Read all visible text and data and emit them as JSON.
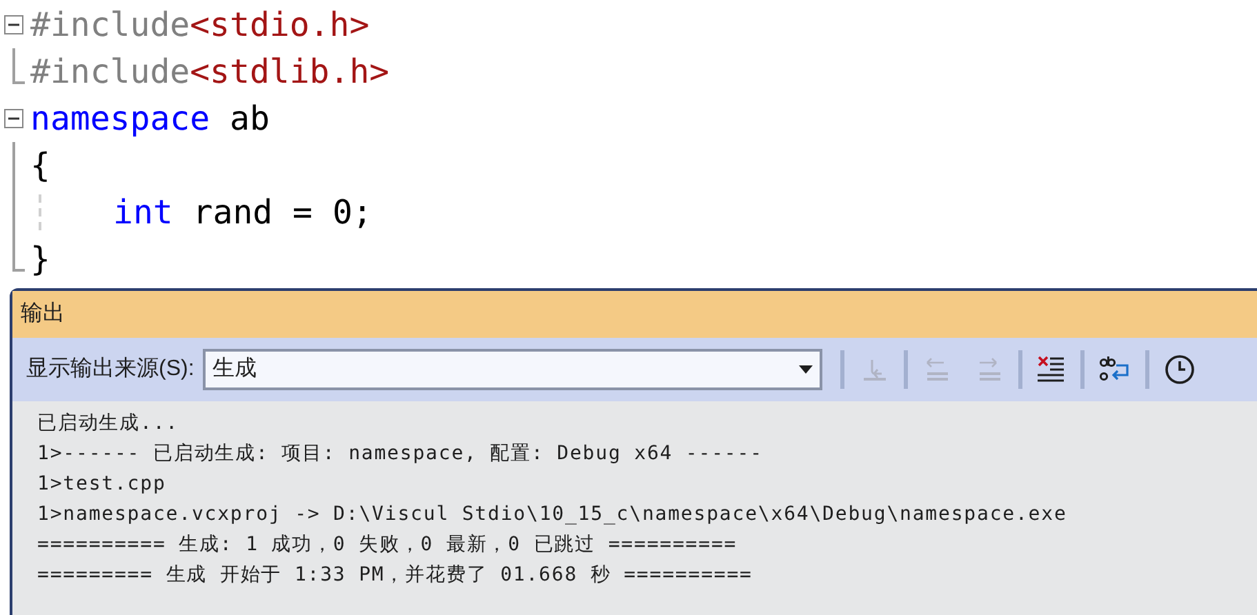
{
  "editor": {
    "lines": [
      {
        "kind": "start",
        "indented": false,
        "tokens": [
          {
            "text": "#include",
            "kind": "directive"
          },
          {
            "text": "<stdio.h>",
            "kind": "header"
          }
        ]
      },
      {
        "kind": "end",
        "indented": false,
        "tokens": [
          {
            "text": "#include",
            "kind": "directive"
          },
          {
            "text": "<stdlib.h>",
            "kind": "header"
          }
        ]
      },
      {
        "kind": "start",
        "indented": false,
        "tokens": [
          {
            "text": "namespace",
            "kind": "keyword"
          },
          {
            "text": " ab",
            "kind": "plain"
          }
        ]
      },
      {
        "kind": "inner",
        "indented": false,
        "tokens": [
          {
            "text": "{",
            "kind": "plain"
          }
        ]
      },
      {
        "kind": "inner",
        "indented": true,
        "tokens": [
          {
            "text": "int",
            "kind": "keyword"
          },
          {
            "text": " rand = 0;",
            "kind": "plain"
          }
        ]
      },
      {
        "kind": "end",
        "indented": false,
        "tokens": [
          {
            "text": "}",
            "kind": "plain"
          }
        ]
      }
    ]
  },
  "output_panel": {
    "title": "输出",
    "source_label": "显示输出来源(S):",
    "source_value": "生成",
    "toolbar": [
      {
        "kind": "goto",
        "disabled": true
      },
      {
        "kind": "outdent",
        "disabled": true
      },
      {
        "kind": "indent",
        "disabled": true
      },
      {
        "kind": "clear",
        "disabled": false
      },
      {
        "kind": "wrap",
        "disabled": false
      },
      {
        "kind": "clock",
        "disabled": false
      }
    ],
    "lines": [
      "已启动生成...",
      "1>------ 已启动生成: 项目: namespace, 配置: Debug x64 ------",
      "1>test.cpp",
      "1>namespace.vcxproj -> D:\\Viscul Stdio\\10_15_c\\namespace\\x64\\Debug\\namespace.exe",
      "========== 生成: 1 成功，0 失败，0 最新，0 已跳过 ==========",
      "========= 生成 开始于 1:33 PM，并花费了 01.668 秒 =========="
    ]
  }
}
